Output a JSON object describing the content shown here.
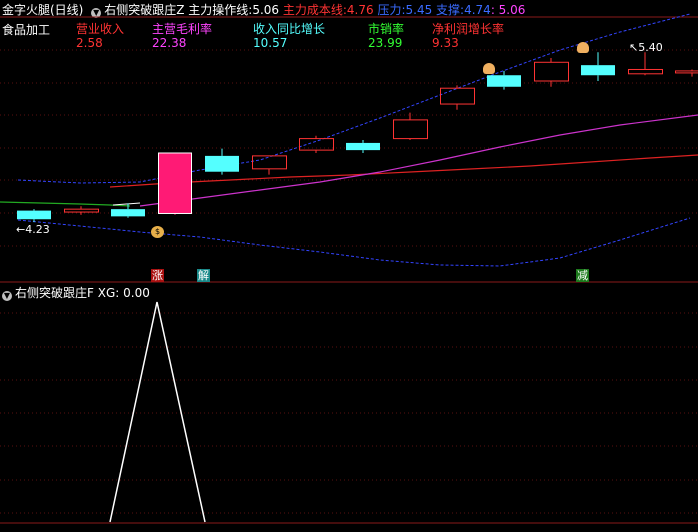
{
  "header": {
    "stock_title": "金字火腿(日线)",
    "indicator_name": "右侧突破跟庄Z",
    "main_line_label": "主力操作线:",
    "main_line_value": "5.06",
    "cost_label": "主力成本线:",
    "cost_value": "4.76",
    "pressure_label": "压力:",
    "pressure_value": "5.45",
    "support_label": "支撑:",
    "support_value": "4.74",
    "support_extra": ": 5.06"
  },
  "fundamentals": {
    "industry": "食品加工",
    "items": [
      {
        "label": "营业收入",
        "value": "2.58",
        "color": "#ff3333"
      },
      {
        "label": "主营毛利率",
        "value": "22.38",
        "color": "#ff44ff"
      },
      {
        "label": "收入同比增长",
        "value": "10.57",
        "color": "#55ffff"
      },
      {
        "label": "市销率",
        "value": "23.99",
        "color": "#33ff33"
      },
      {
        "label": "净利润增长率",
        "value": "9.33",
        "color": "#ff3333"
      }
    ]
  },
  "price_labels": {
    "high": "5.40",
    "low": "4.23"
  },
  "signals": {
    "zhang": "涨",
    "jie": "解",
    "jian": "减"
  },
  "lower_panel": {
    "title": "右侧突破跟庄F",
    "xg_label": "XG:",
    "xg_value": "0.00"
  },
  "colors": {
    "up": "#ff3333",
    "down": "#54ffff",
    "limit_up": "#ff1a75",
    "cost_line": "#dd2222",
    "ma_line": "#cc33cc",
    "band": "#3344ff",
    "green_line": "#22aa22"
  },
  "candles": [
    {
      "o": 4.3,
      "c": 4.24,
      "h": 4.31,
      "l": 4.22,
      "type": "down"
    },
    {
      "o": 4.29,
      "c": 4.31,
      "h": 4.33,
      "l": 4.27,
      "type": "up"
    },
    {
      "o": 4.31,
      "c": 4.26,
      "h": 4.35,
      "l": 4.25,
      "type": "down"
    },
    {
      "o": 4.28,
      "c": 4.7,
      "h": 4.7,
      "l": 4.27,
      "type": "limit_up"
    },
    {
      "o": 4.68,
      "c": 4.57,
      "h": 4.73,
      "l": 4.55,
      "type": "down"
    },
    {
      "o": 4.59,
      "c": 4.68,
      "h": 4.68,
      "l": 4.55,
      "type": "up"
    },
    {
      "o": 4.72,
      "c": 4.8,
      "h": 4.82,
      "l": 4.7,
      "type": "up"
    },
    {
      "o": 4.77,
      "c": 4.72,
      "h": 4.79,
      "l": 4.7,
      "type": "down"
    },
    {
      "o": 4.8,
      "c": 4.93,
      "h": 4.98,
      "l": 4.79,
      "type": "up"
    },
    {
      "o": 5.04,
      "c": 5.15,
      "h": 5.17,
      "l": 5.0,
      "type": "up"
    },
    {
      "o": 5.24,
      "c": 5.16,
      "h": 5.27,
      "l": 5.14,
      "type": "down"
    },
    {
      "o": 5.2,
      "c": 5.33,
      "h": 5.36,
      "l": 5.16,
      "type": "up"
    },
    {
      "o": 5.31,
      "c": 5.24,
      "h": 5.4,
      "l": 5.2,
      "type": "down"
    },
    {
      "o": 5.25,
      "c": 5.28,
      "h": 5.4,
      "l": 5.24,
      "type": "up"
    },
    {
      "o": 5.27,
      "c": 5.26,
      "h": 5.28,
      "l": 5.23,
      "type": "up"
    }
  ],
  "xg_series": [
    0,
    0,
    0,
    1,
    0,
    0,
    0,
    0,
    0,
    0,
    0,
    0,
    0,
    0,
    0
  ]
}
